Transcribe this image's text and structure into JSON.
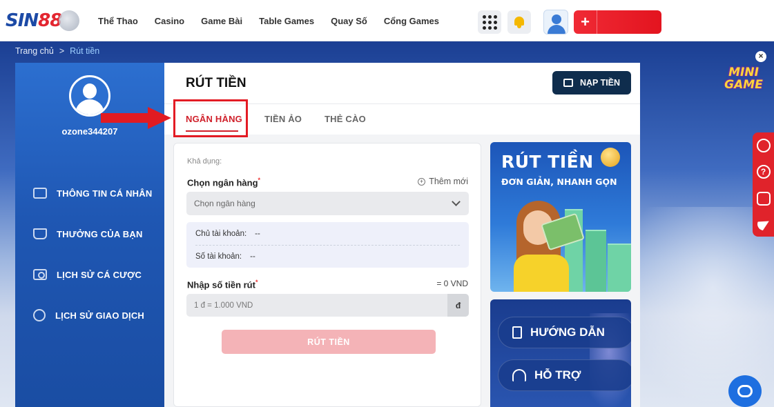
{
  "header": {
    "logo": "SIN88",
    "nav": [
      "Thể Thao",
      "Casino",
      "Game Bài",
      "Table Games",
      "Quay Số",
      "Cổng Games"
    ],
    "icons": [
      "apps-grid-icon",
      "bell-icon",
      "user-avatar-icon",
      "plus-icon"
    ],
    "accent_color": "#e3141f"
  },
  "breadcrumb": {
    "home": "Trang chủ",
    "separator": ">",
    "current": "Rút tiền"
  },
  "sidebar": {
    "username": "ozone344207",
    "items": [
      {
        "label": "THÔNG TIN CÁ NHÂN",
        "icon": "profile-card-icon"
      },
      {
        "label": "THƯỞNG CỦA BẠN",
        "icon": "gift-icon"
      },
      {
        "label": "LỊCH SỬ CÁ CƯỢC",
        "icon": "cash-icon"
      },
      {
        "label": "LỊCH SỬ GIAO DỊCH",
        "icon": "history-icon"
      }
    ]
  },
  "main": {
    "title": "RÚT TIỀN",
    "deposit_button": "NẠP TIỀN",
    "tabs": [
      {
        "label": "NGÂN HÀNG",
        "active": true
      },
      {
        "label": "TIỀN ẢO",
        "active": false
      },
      {
        "label": "THẺ CÀO",
        "active": false
      }
    ]
  },
  "form": {
    "available_label": "Khả dụng:",
    "bank_label": "Chọn ngân hàng",
    "required_mark": "*",
    "add_new": "Thêm mới",
    "bank_placeholder": "Chọn ngân hàng",
    "account_holder_label": "Chủ tài khoản:",
    "account_holder_value": "--",
    "account_number_label": "Số tài khoản:",
    "account_number_value": "--",
    "amount_label": "Nhập số tiền rút",
    "amount_converted": "= 0 VND",
    "amount_placeholder": "1 đ = 1.000 VND",
    "amount_unit": "đ",
    "submit": "RÚT TIỀN"
  },
  "promo": {
    "title": "RÚT TIỀN",
    "subtitle": "ĐƠN GIẢN, NHANH GỌN"
  },
  "help": {
    "guide": "HƯỚNG DẪN",
    "support": "HỖ TRỢ"
  },
  "minigame": {
    "label_line1": "MINI",
    "label_line2": "GAME",
    "close": "×"
  },
  "float_bar": {
    "icons": [
      "user-circle-icon",
      "question-icon",
      "chat-icon",
      "telegram-icon"
    ],
    "question_glyph": "?"
  }
}
